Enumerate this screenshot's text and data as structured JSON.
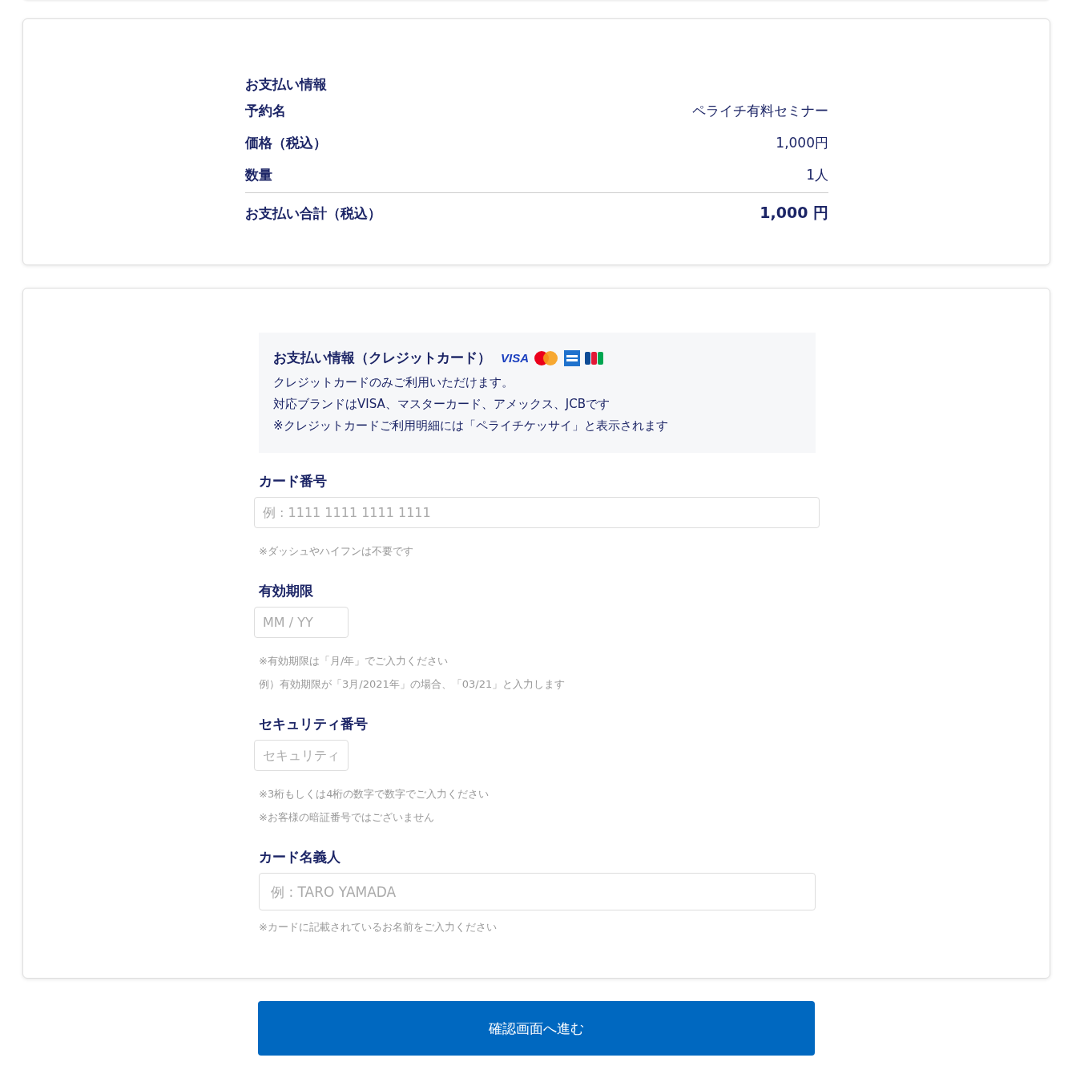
{
  "summary": {
    "title": "お支払い情報",
    "rows": [
      {
        "label": "予約名",
        "value": "ペライチ有料セミナー",
        "kind": "normal"
      },
      {
        "label": "価格（税込）",
        "value": "1,000円",
        "kind": "normal"
      },
      {
        "label": "数量",
        "value": "1人",
        "kind": "normal"
      },
      {
        "label": "お支払い合計（税込）",
        "value": "1,000 円",
        "kind": "total"
      }
    ]
  },
  "payment": {
    "title": "お支払い情報（クレジットカード）",
    "brands": [
      {
        "kind": "visa",
        "label": "VISA"
      },
      {
        "kind": "mastercard"
      },
      {
        "kind": "amex"
      },
      {
        "kind": "jcb"
      }
    ],
    "notes": [
      "クレジットカードのみご利用いただけます。",
      "対応ブランドはVISA、マスターカード、アメックス、JCBです",
      "※クレジットカードご利用明細には「ペライチケッサイ」と表示されます"
    ]
  },
  "fields": [
    {
      "label": "カード番号",
      "placeholder": "例 : 1111 1111 1111 1111",
      "kind": "wide",
      "hints": [
        "※ダッシュやハイフンは不要です"
      ]
    },
    {
      "label": "有効期限",
      "placeholder": "MM / YY",
      "kind": "narrow",
      "hints": [
        "※有効期限は「月/年」でご入力ください",
        "例）有効期限が「3月/2021年」の場合、「03/21」と入力します"
      ]
    },
    {
      "label": "セキュリティ番号",
      "placeholder": "セキュリティ",
      "kind": "narrow",
      "hints": [
        "※3桁もしくは4桁の数字で数字でご入力ください",
        "※お客様の暗証番号ではございません"
      ]
    },
    {
      "label": "カード名義人",
      "placeholder": "例 : TARO YAMADA",
      "kind": "large",
      "hints": [
        "※カードに記載されているお名前をご入力ください"
      ]
    }
  ],
  "submit": "確認画面へ進む"
}
